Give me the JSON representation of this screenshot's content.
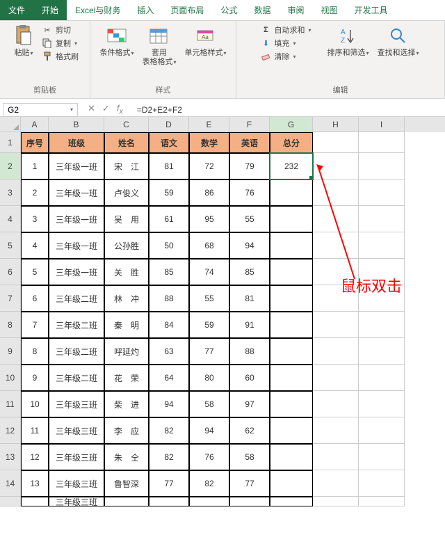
{
  "tabs": [
    "文件",
    "开始",
    "Excel与财务",
    "插入",
    "页面布局",
    "公式",
    "数据",
    "审阅",
    "视图",
    "开发工具"
  ],
  "active_tab": 1,
  "ribbon": {
    "clipboard": {
      "paste": "粘贴",
      "cut": "剪切",
      "copy": "复制",
      "format_painter": "格式刷",
      "label": "剪贴板"
    },
    "styles": {
      "cond_fmt": "条件格式",
      "table_fmt": "套用\n表格格式",
      "cell_fmt": "单元格样式",
      "label": "样式"
    },
    "editing": {
      "autosum": "自动求和",
      "fill": "填充",
      "clear": "清除",
      "sort_filter": "排序和筛选",
      "find_select": "查找和选择",
      "label": "编辑"
    }
  },
  "namebox": "G2",
  "formula": "=D2+E2+F2",
  "columns": [
    "A",
    "B",
    "C",
    "D",
    "E",
    "F",
    "G",
    "H",
    "I"
  ],
  "headers": {
    "A": "序号",
    "B": "班级",
    "C": "姓名",
    "D": "语文",
    "E": "数学",
    "F": "英语",
    "G": "总分"
  },
  "data_rows": [
    {
      "A": "1",
      "B": "三年级一班",
      "C": "宋　江",
      "D": "81",
      "E": "72",
      "F": "79",
      "G": "232"
    },
    {
      "A": "2",
      "B": "三年级一班",
      "C": "卢俊义",
      "D": "59",
      "E": "86",
      "F": "76",
      "G": ""
    },
    {
      "A": "3",
      "B": "三年级一班",
      "C": "吴　用",
      "D": "61",
      "E": "95",
      "F": "55",
      "G": ""
    },
    {
      "A": "4",
      "B": "三年级一班",
      "C": "公孙胜",
      "D": "50",
      "E": "68",
      "F": "94",
      "G": ""
    },
    {
      "A": "5",
      "B": "三年级一班",
      "C": "关　胜",
      "D": "85",
      "E": "74",
      "F": "85",
      "G": ""
    },
    {
      "A": "6",
      "B": "三年级二班",
      "C": "林　冲",
      "D": "88",
      "E": "55",
      "F": "81",
      "G": ""
    },
    {
      "A": "7",
      "B": "三年级二班",
      "C": "秦　明",
      "D": "84",
      "E": "59",
      "F": "91",
      "G": ""
    },
    {
      "A": "8",
      "B": "三年级二班",
      "C": "呼延灼",
      "D": "63",
      "E": "77",
      "F": "88",
      "G": ""
    },
    {
      "A": "9",
      "B": "三年级二班",
      "C": "花　荣",
      "D": "64",
      "E": "80",
      "F": "60",
      "G": ""
    },
    {
      "A": "10",
      "B": "三年级三班",
      "C": "柴　进",
      "D": "94",
      "E": "58",
      "F": "97",
      "G": ""
    },
    {
      "A": "11",
      "B": "三年级三班",
      "C": "李　应",
      "D": "82",
      "E": "94",
      "F": "62",
      "G": ""
    },
    {
      "A": "12",
      "B": "三年级三班",
      "C": "朱　仝",
      "D": "82",
      "E": "76",
      "F": "58",
      "G": ""
    },
    {
      "A": "13",
      "B": "三年级三班",
      "C": "鲁智深",
      "D": "77",
      "E": "82",
      "F": "77",
      "G": ""
    }
  ],
  "partial_row": {
    "B": "三年级三班"
  },
  "annotation": "鼠标双击",
  "selected_cell": "G2"
}
